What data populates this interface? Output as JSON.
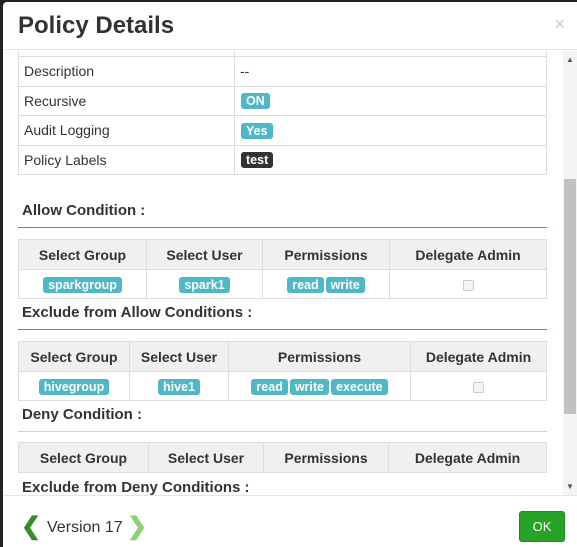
{
  "title": "Policy Details",
  "close": "×",
  "info": [
    {
      "label": "Description",
      "value": "--"
    },
    {
      "label": "Recursive",
      "badge": "ON"
    },
    {
      "label": "Audit Logging",
      "badge": "Yes"
    },
    {
      "label": "Policy Labels",
      "badge": "test"
    }
  ],
  "headers": [
    "Select Group",
    "Select User",
    "Permissions",
    "Delegate Admin"
  ],
  "allow": {
    "title": "Allow Condition :",
    "group": "sparkgroup",
    "user": "spark1",
    "perms": [
      "read",
      "write"
    ]
  },
  "exclude_allow": {
    "title": "Exclude from Allow Conditions :",
    "group": "hivegroup",
    "user": "hive1",
    "perms": [
      "read",
      "write",
      "execute"
    ]
  },
  "deny": {
    "title": "Deny Condition :"
  },
  "exclude_deny": {
    "title": "Exclude from Deny Conditions :"
  },
  "footer": {
    "version": "Version 17",
    "ok": "OK",
    "prev_icon": "chevron-left",
    "next_icon": "chevron-right"
  },
  "colors": {
    "label": "#4fb7c5",
    "ok": "#27a327",
    "chevron_prev": "#3a8a2a",
    "chevron_next": "#8fcf7a"
  }
}
